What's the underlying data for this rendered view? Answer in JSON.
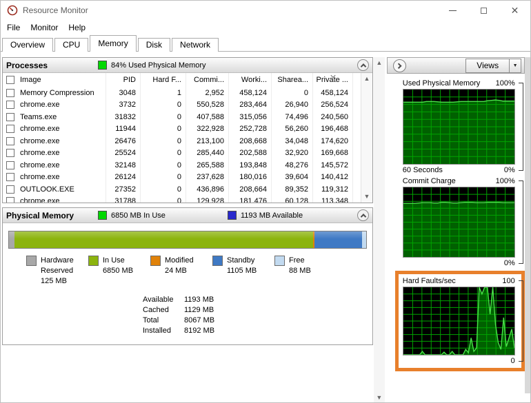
{
  "window": {
    "title": "Resource Monitor"
  },
  "menu": {
    "items": [
      "File",
      "Monitor",
      "Help"
    ]
  },
  "tabs": {
    "items": [
      "Overview",
      "CPU",
      "Memory",
      "Disk",
      "Network"
    ],
    "active": "Memory"
  },
  "processes": {
    "title": "Processes",
    "status": "84% Used Physical Memory",
    "columns": [
      "Image",
      "PID",
      "Hard F...",
      "Commi...",
      "Worki...",
      "Sharea...",
      "Private ..."
    ],
    "sorted_column": "Private ...",
    "rows": [
      {
        "image": "Memory Compression",
        "pid": "3048",
        "hard": "1",
        "commit": "2,952",
        "working": "458,124",
        "shareable": "0",
        "private": "458,124"
      },
      {
        "image": "chrome.exe",
        "pid": "3732",
        "hard": "0",
        "commit": "550,528",
        "working": "283,464",
        "shareable": "26,940",
        "private": "256,524"
      },
      {
        "image": "Teams.exe",
        "pid": "31832",
        "hard": "0",
        "commit": "407,588",
        "working": "315,056",
        "shareable": "74,496",
        "private": "240,560"
      },
      {
        "image": "chrome.exe",
        "pid": "11944",
        "hard": "0",
        "commit": "322,928",
        "working": "252,728",
        "shareable": "56,260",
        "private": "196,468"
      },
      {
        "image": "chrome.exe",
        "pid": "26476",
        "hard": "0",
        "commit": "213,100",
        "working": "208,668",
        "shareable": "34,048",
        "private": "174,620"
      },
      {
        "image": "chrome.exe",
        "pid": "25524",
        "hard": "0",
        "commit": "285,440",
        "working": "202,588",
        "shareable": "32,920",
        "private": "169,668"
      },
      {
        "image": "chrome.exe",
        "pid": "32148",
        "hard": "0",
        "commit": "265,588",
        "working": "193,848",
        "shareable": "48,276",
        "private": "145,572"
      },
      {
        "image": "chrome.exe",
        "pid": "26124",
        "hard": "0",
        "commit": "237,628",
        "working": "180,016",
        "shareable": "39,604",
        "private": "140,412"
      },
      {
        "image": "OUTLOOK.EXE",
        "pid": "27352",
        "hard": "0",
        "commit": "436,896",
        "working": "208,664",
        "shareable": "89,352",
        "private": "119,312"
      },
      {
        "image": "chrome.exe",
        "pid": "31788",
        "hard": "0",
        "commit": "129,928",
        "working": "181,476",
        "shareable": "60,128",
        "private": "113,348"
      }
    ]
  },
  "physical_memory": {
    "title": "Physical Memory",
    "in_use_status": "6850 MB In Use",
    "available_status": "1193 MB Available",
    "bar_segments": [
      {
        "name": "hardware-reserved",
        "pct": 1.53,
        "color": "#a8a8a8"
      },
      {
        "name": "in-use",
        "pct": 83.62,
        "color": "#8cb40e"
      },
      {
        "name": "modified",
        "pct": 0.4,
        "color": "#e0820a"
      },
      {
        "name": "standby",
        "pct": 13.37,
        "color": "#3f79c4"
      },
      {
        "name": "free",
        "pct": 1.08,
        "color": "#c2daf0"
      }
    ],
    "legend": [
      {
        "label": "Hardware\nReserved",
        "value": "125 MB",
        "color": "#a8a8a8"
      },
      {
        "label": "In Use",
        "value": "6850 MB",
        "color": "#8cb40e"
      },
      {
        "label": "Modified",
        "value": "24 MB",
        "color": "#e0820a"
      },
      {
        "label": "Standby",
        "value": "1105 MB",
        "color": "#3f79c4"
      },
      {
        "label": "Free",
        "value": "88 MB",
        "color": "#c2daf0"
      }
    ],
    "stats": [
      {
        "label": "Available",
        "value": "1193 MB"
      },
      {
        "label": "Cached",
        "value": "1129 MB"
      },
      {
        "label": "Total",
        "value": "8067 MB"
      },
      {
        "label": "Installed",
        "value": "8192 MB"
      }
    ]
  },
  "right_panel": {
    "views_label": "Views"
  },
  "colors": {
    "header_green": "#00d800",
    "header_blue": "#2929cc",
    "graph_bg": "#000000",
    "graph_grid": "#00a400",
    "graph_fill": "#006000",
    "graph_line": "#4ae04a",
    "highlight_orange": "#E8802C"
  },
  "chart_data": [
    {
      "type": "area",
      "title": "Used Physical Memory",
      "ymax_label": "100%",
      "ymin_label": "0%",
      "xlabel": "60 Seconds",
      "ylim": [
        0,
        100
      ],
      "grid": {
        "cols": 12,
        "rows": 10
      },
      "values": [
        83,
        83,
        83,
        83,
        83,
        83,
        84,
        84,
        84,
        83.5,
        83,
        83,
        83,
        83,
        83.5,
        84,
        84,
        84,
        84,
        84,
        84,
        84,
        85,
        85.5,
        86,
        85.5,
        84.5,
        84.5,
        84.5,
        84.5
      ]
    },
    {
      "type": "area",
      "title": "Commit Charge",
      "ymax_label": "100%",
      "ymin_label": "0%",
      "xlabel": "",
      "ylim": [
        0,
        100
      ],
      "grid": {
        "cols": 12,
        "rows": 10
      },
      "values": [
        77,
        77,
        77,
        77,
        77.5,
        78,
        78,
        78,
        77.5,
        77.5,
        78.5,
        78.5,
        78,
        77.5,
        77.5,
        78,
        78.5,
        78.5,
        78.5,
        78,
        78,
        78,
        78.5,
        78.5,
        78.5,
        78.5,
        78,
        78,
        78,
        78
      ]
    },
    {
      "type": "area",
      "title": "Hard Faults/sec",
      "ymax_label": "100",
      "ymin_label": "0",
      "xlabel": "",
      "ylim": [
        0,
        100
      ],
      "grid": {
        "cols": 12,
        "rows": 10
      },
      "highlighted": true,
      "values": [
        0,
        0,
        0,
        0,
        0,
        0,
        0,
        5,
        0,
        0,
        0,
        0,
        0,
        0,
        0,
        4,
        0,
        0,
        5,
        0,
        0,
        0,
        0,
        8,
        3,
        25,
        5,
        10,
        100,
        90,
        100,
        100,
        60,
        100,
        45,
        18,
        8,
        55,
        12,
        25,
        38,
        10
      ]
    }
  ]
}
